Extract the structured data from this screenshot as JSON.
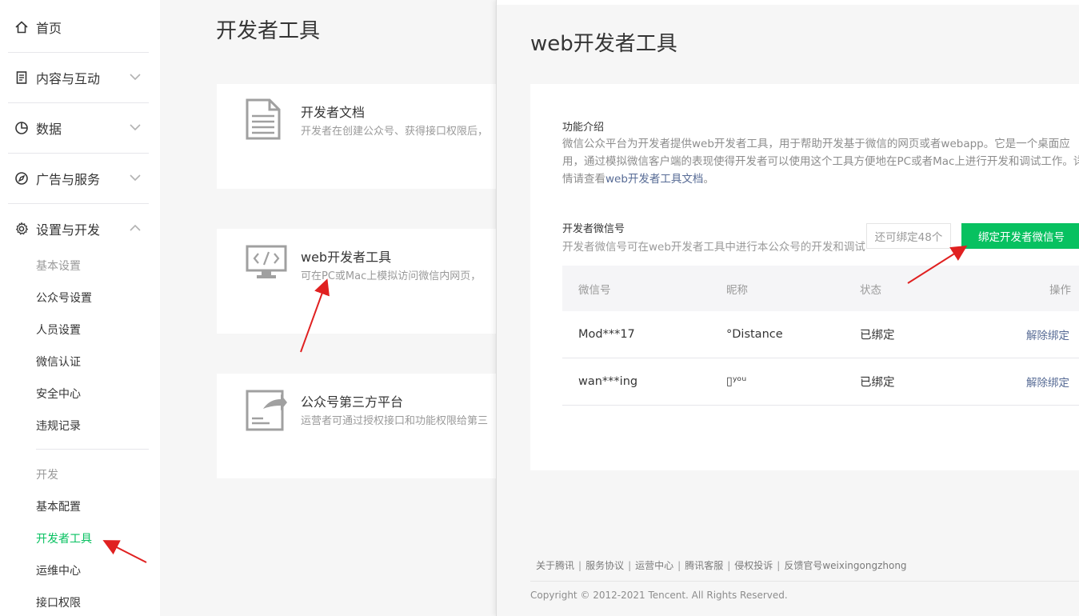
{
  "sidebar": {
    "home": "首页",
    "content": "内容与互动",
    "data": "数据",
    "ads": "广告与服务",
    "settings": "设置与开发",
    "basic_head": "基本设置",
    "basic_items": [
      "公众号设置",
      "人员设置",
      "微信认证",
      "安全中心",
      "违规记录"
    ],
    "dev_head": "开发",
    "dev_items": [
      "基本配置",
      "开发者工具",
      "运维中心",
      "接口权限"
    ],
    "active_item": "开发者工具"
  },
  "main": {
    "title": "开发者工具",
    "cards": [
      {
        "title": "开发者文档",
        "desc": "开发者在创建公众号、获得接口权限后，"
      },
      {
        "title": "web开发者工具",
        "desc": "可在PC或Mac上模拟访问微信内网页，"
      },
      {
        "title": "公众号第三方平台",
        "desc": "运营者可通过授权接口和功能权限给第三"
      }
    ]
  },
  "drawer": {
    "title": "web开发者工具",
    "intro_label": "功能介绍",
    "intro_text": "微信公众平台为开发者提供web开发者工具，用于帮助开发基于微信的网页或者webapp。它是一个桌面应用，通过模拟微信客户端的表现使得开发者可以使用这个工具方便地在PC或者Mac上进行开发和调试工作。详情请查看",
    "intro_link": "web开发者工具文档",
    "intro_end": "。",
    "wx_label": "开发者微信号",
    "wx_desc": "开发者微信号可在web开发者工具中进行本公众号的开发和调试",
    "remain_label": "还可绑定48个",
    "bind_button": "绑定开发者微信号",
    "table": {
      "headers": [
        "微信号",
        "昵称",
        "状态",
        "操作"
      ],
      "rows": [
        {
          "wechat": "Mod***17",
          "nickname": "°Distance",
          "status": "已绑定",
          "action": "解除绑定"
        },
        {
          "wechat": "wan***ing",
          "nickname": "▯ʸᵒᵘ",
          "status": "已绑定",
          "action": "解除绑定"
        }
      ]
    },
    "footer_links": [
      "关于腾讯",
      "服务协议",
      "运营中心",
      "腾讯客服",
      "侵权投诉",
      "反馈官号weixingongzhong"
    ],
    "copyright": "Copyright © 2012-2021 Tencent. All Rights Reserved."
  },
  "colors": {
    "accent_green": "#07c160",
    "link_blue": "#576b95",
    "annotation_red": "#e02020"
  }
}
